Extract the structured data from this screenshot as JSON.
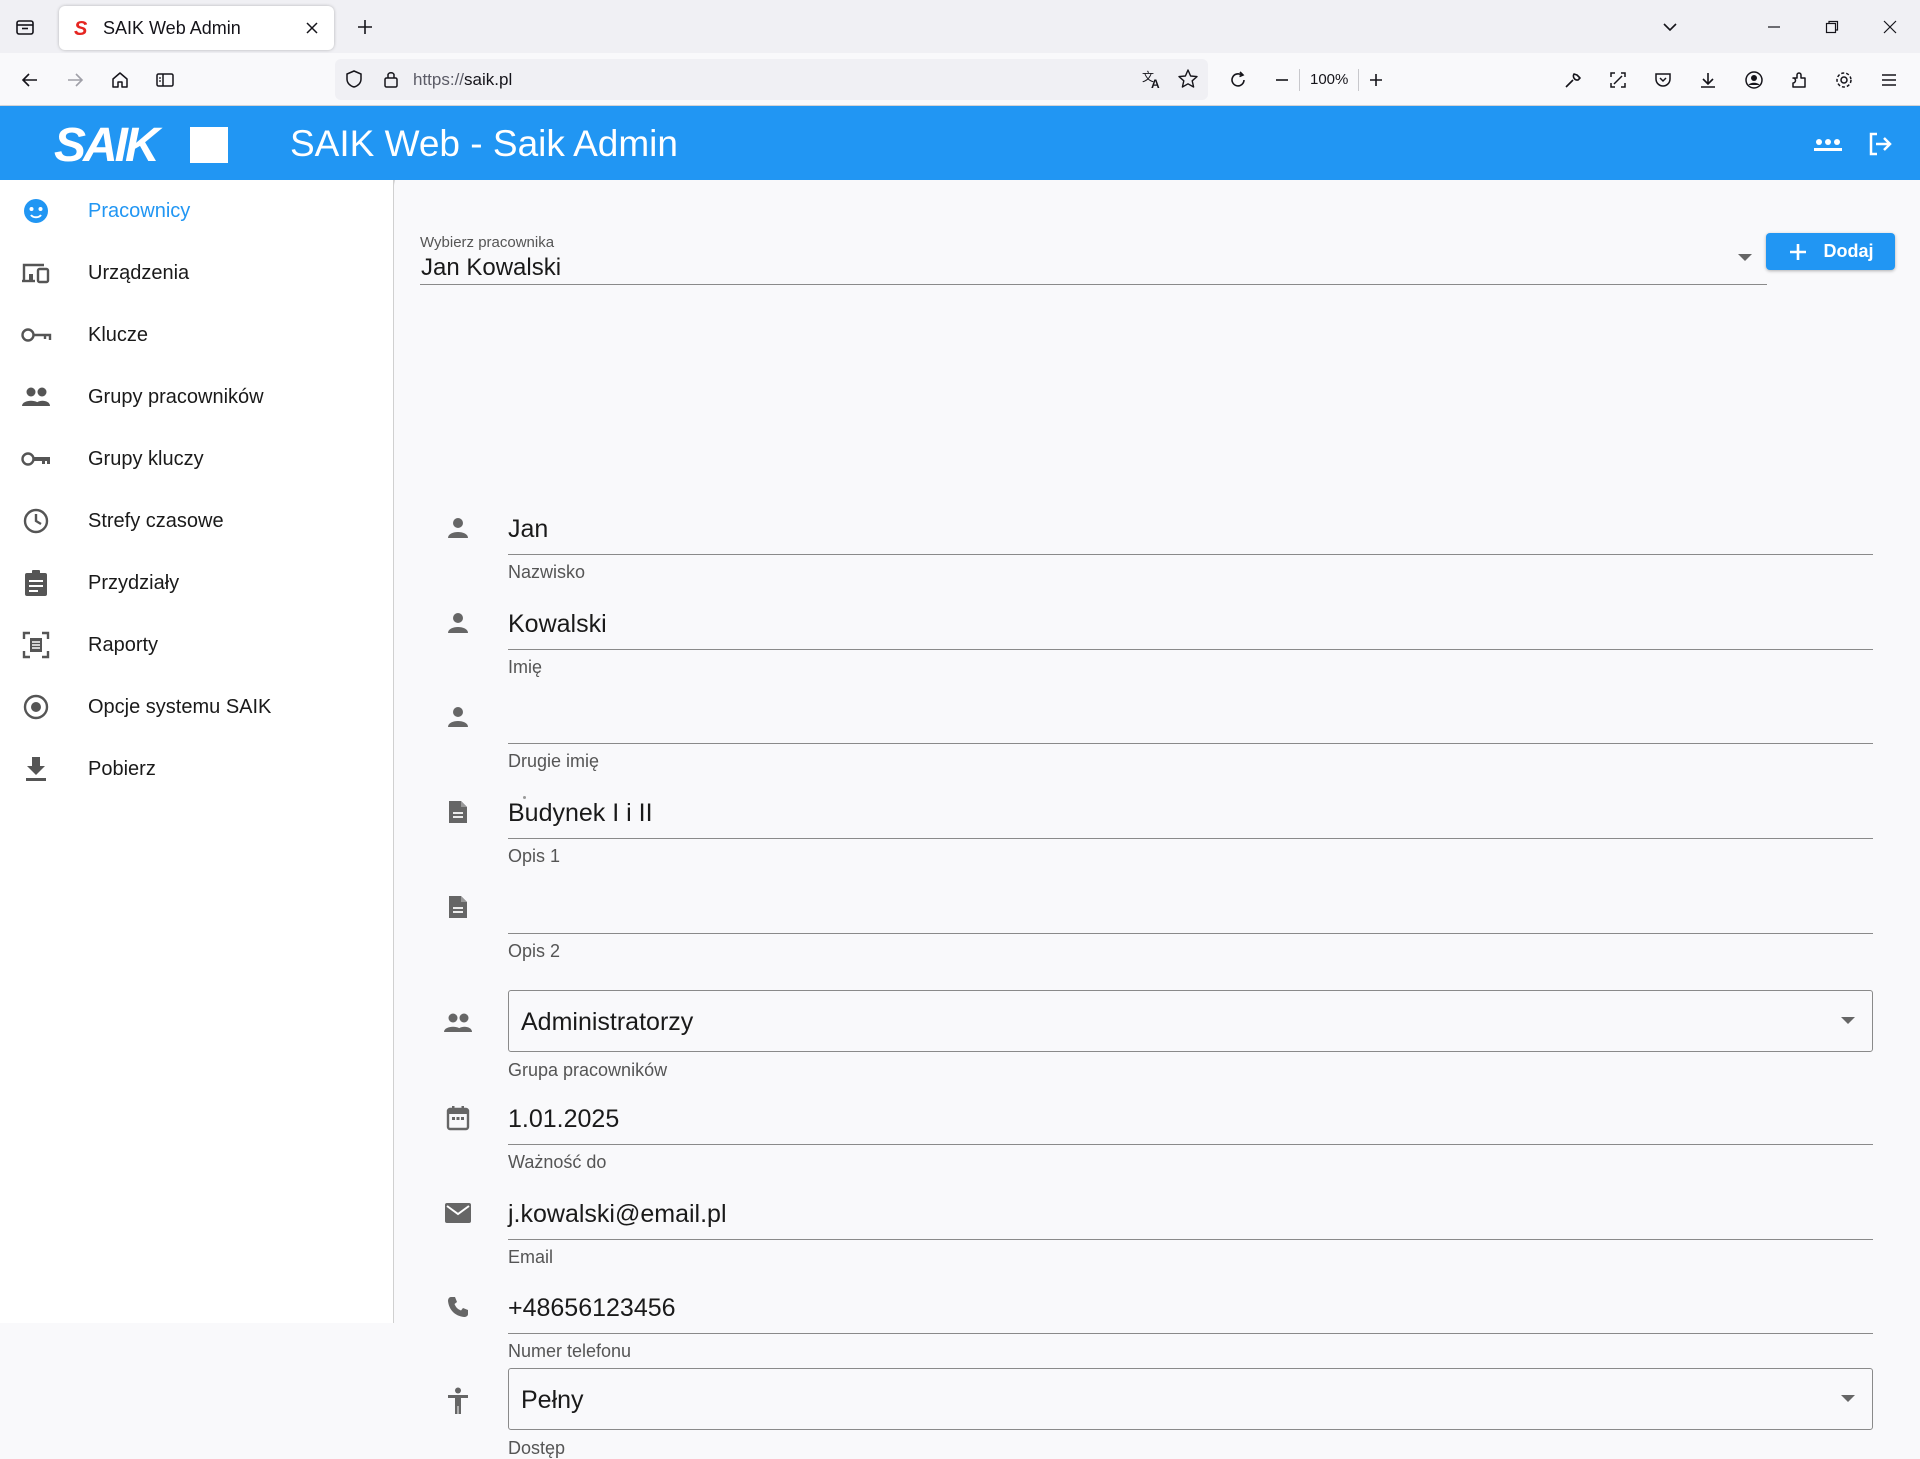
{
  "browser": {
    "tab_title": "SAIK Web Admin",
    "url_scheme": "https://",
    "url_host": "saik.pl",
    "zoom": "100%"
  },
  "app": {
    "title": "SAIK Web - Saik Admin",
    "logo_text": "SAIK",
    "accent_color": "#2196f3"
  },
  "sidebar": {
    "items": [
      {
        "label": "Pracownicy",
        "icon": "face-icon",
        "active": true
      },
      {
        "label": "Urządzenia",
        "icon": "devices-icon"
      },
      {
        "label": "Klucze",
        "icon": "vpn-key-icon"
      },
      {
        "label": "Grupy pracowników",
        "icon": "people-icon"
      },
      {
        "label": "Grupy kluczy",
        "icon": "key-icon"
      },
      {
        "label": "Strefy czasowe",
        "icon": "clock-icon"
      },
      {
        "label": "Przydziały",
        "icon": "assignment-icon"
      },
      {
        "label": "Raporty",
        "icon": "report-icon"
      },
      {
        "label": "Opcje systemu SAIK",
        "icon": "radio-button-icon"
      },
      {
        "label": "Pobierz",
        "icon": "download-icon"
      }
    ]
  },
  "employee_select": {
    "label": "Wybierz pracownika",
    "value": "Jan Kowalski"
  },
  "add_button": {
    "label": "Dodaj"
  },
  "form": {
    "nazwisko": {
      "value": "Jan",
      "label": "Nazwisko"
    },
    "imie": {
      "value": "Kowalski",
      "label": "Imię"
    },
    "drugie_imie": {
      "value": "",
      "label": "Drugie imię"
    },
    "opis1": {
      "value": "Budynek I i II",
      "label": "Opis 1"
    },
    "opis2": {
      "value": "",
      "label": "Opis 2"
    },
    "grupa": {
      "value": "Administratorzy",
      "label": "Grupa pracowników"
    },
    "waznosc": {
      "value": "1.01.2025",
      "label": "Ważność do"
    },
    "email": {
      "value": "j.kowalski@email.pl",
      "label": "Email"
    },
    "telefon": {
      "value": "+48656123456",
      "label": "Numer telefonu"
    },
    "dostep": {
      "value": "Pełny",
      "label": "Dostęp"
    }
  }
}
